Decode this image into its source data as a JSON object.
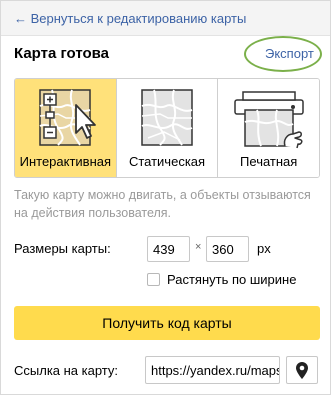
{
  "back_link": "← Вернуться к редактированию карты",
  "title": "Карта готова",
  "export_link": "Экспорт",
  "map_types": [
    {
      "label": "Интерактивная",
      "icon": "interactive-map-icon",
      "selected": true
    },
    {
      "label": "Статическая",
      "icon": "static-map-icon",
      "selected": false
    },
    {
      "label": "Печатная",
      "icon": "printer-map-icon",
      "selected": false
    }
  ],
  "description": "Такую карту можно двигать, а объекты отзываются на действия пользователя.",
  "size": {
    "label": "Размеры карты:",
    "width": "439",
    "height": "360",
    "separator": "×",
    "unit": "px"
  },
  "stretch": {
    "label": "Растянуть по ширине",
    "checked": false
  },
  "get_code_button": "Получить код карты",
  "map_link": {
    "label": "Ссылка на карту:",
    "value": "https://yandex.ru/maps/",
    "pin_icon": "map-pin-icon"
  },
  "colors": {
    "selected_type": "#ffe17a",
    "button": "#ffdb4d",
    "link": "#3d63a6",
    "highlight_ring": "#7bb04a"
  }
}
